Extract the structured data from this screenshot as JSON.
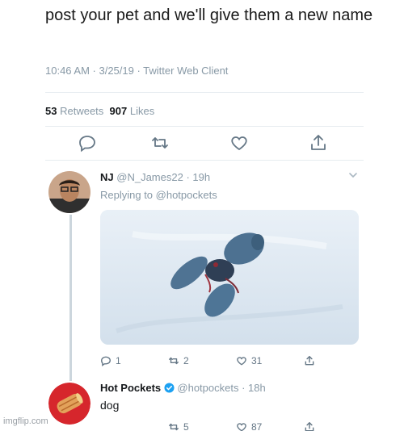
{
  "tweet": {
    "text": "post your pet and we'll give them a new name",
    "meta": "10:46 AM · 3/25/19 · Twitter Web Client",
    "retweets_count": "53",
    "retweets_label": "Retweets",
    "likes_count": "907",
    "likes_label": "Likes"
  },
  "reply1": {
    "name": "NJ",
    "handle": "@N_James22",
    "time": "· 19h",
    "replying": "Replying to @hotpockets",
    "reply_count": "1",
    "retweet_count": "2",
    "like_count": "31"
  },
  "reply2": {
    "name": "Hot Pockets",
    "handle": "@hotpockets",
    "time": "· 18h",
    "text": "dog",
    "retweet_count": "5",
    "like_count": "87"
  },
  "watermark": "imgflip.com",
  "colors": {
    "muted": "#8899a6",
    "icon": "#657786",
    "verified": "#1da1f2",
    "divider": "#e6ecf0"
  },
  "icons": [
    "reply-icon",
    "retweet-icon",
    "like-icon",
    "share-icon",
    "chevron-down-icon",
    "verified-badge-icon"
  ]
}
